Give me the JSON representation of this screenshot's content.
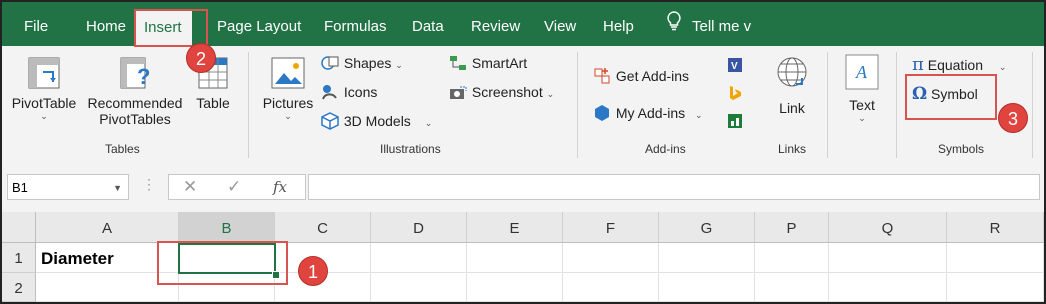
{
  "tabs": [
    {
      "label": "File"
    },
    {
      "label": "Home"
    },
    {
      "label": "Insert",
      "active": true
    },
    {
      "label": "Page Layout"
    },
    {
      "label": "Formulas"
    },
    {
      "label": "Data"
    },
    {
      "label": "Review"
    },
    {
      "label": "View"
    },
    {
      "label": "Help"
    },
    {
      "label": "Tell me v"
    }
  ],
  "ribbon": {
    "tables": {
      "label": "Tables",
      "pivot_table": "PivotTable",
      "recommended_line1": "Recommended",
      "recommended_line2": "PivotTables",
      "table": "Table"
    },
    "illustrations": {
      "label": "Illustrations",
      "pictures": "Pictures",
      "shapes": "Shapes",
      "icons": "Icons",
      "models3d": "3D Models",
      "smartart": "SmartArt",
      "screenshot": "Screenshot"
    },
    "addins": {
      "label": "Add-ins",
      "get_addins": "Get Add-ins",
      "my_addins": "My Add-ins"
    },
    "links": {
      "label": "Links",
      "link": "Link"
    },
    "text": {
      "text": "Text"
    },
    "symbols": {
      "label": "Symbols",
      "equation": "Equation",
      "symbol": "Symbol"
    }
  },
  "formula_bar": {
    "name_box": "B1",
    "fx": "fx",
    "value": ""
  },
  "grid": {
    "columns": [
      "A",
      "B",
      "C",
      "D",
      "E",
      "F",
      "G",
      "P",
      "Q",
      "R"
    ],
    "rows": [
      "1",
      "2"
    ],
    "cells": {
      "A1": "Diameter",
      "B1": ""
    },
    "selected_cell": "B1"
  },
  "annotations": [
    "1",
    "2",
    "3"
  ],
  "colors": {
    "excel_green": "#217346",
    "annotation_red": "#e0443e"
  }
}
